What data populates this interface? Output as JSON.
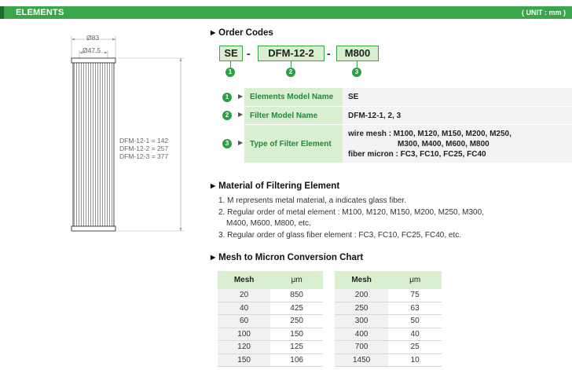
{
  "header": {
    "title": "ELEMENTS",
    "unit": "( UNIT : mm )"
  },
  "drawing": {
    "dim_outer": "Ø83",
    "dim_inner": "Ø47.5",
    "lengths": [
      "DFM-12-1 = 142",
      "DFM-12-2 = 257",
      "DFM-12-3 = 377"
    ]
  },
  "order_codes": {
    "heading": "Order Codes",
    "codes": [
      "SE",
      "DFM-12-2",
      "M800"
    ],
    "dash": "-",
    "numbers": [
      "1",
      "2",
      "3"
    ],
    "definitions": [
      {
        "num": "1",
        "label": "Elements Model Name",
        "value_lines": [
          "SE"
        ]
      },
      {
        "num": "2",
        "label": "Filter Model Name",
        "value_lines": [
          "DFM-12-1, 2, 3"
        ]
      },
      {
        "num": "3",
        "label": "Type of Filter Element",
        "value_lines": [
          "wire mesh : M100, M120, M150, M200, M250,",
          "M300, M400, M600, M800",
          "fiber micron : FC3, FC10, FC25, FC40"
        ]
      }
    ]
  },
  "material": {
    "heading": "Material of Filtering Element",
    "items": [
      [
        "1. M represents metal material, a indicates glass fiber."
      ],
      [
        "2. Regular order of metal element : M100, M120, M150, M200, M250, M300,",
        "M400, M600, M800, etc."
      ],
      [
        "3. Regular order of glass fiber element : FC3, FC10, FC25, FC40, etc."
      ]
    ]
  },
  "conversion": {
    "heading": "Mesh to Micron Conversion Chart",
    "col_mesh": "Mesh",
    "col_um": "μm",
    "left": [
      [
        "20",
        "850"
      ],
      [
        "40",
        "425"
      ],
      [
        "60",
        "250"
      ],
      [
        "100",
        "150"
      ],
      [
        "120",
        "125"
      ],
      [
        "150",
        "106"
      ]
    ],
    "right": [
      [
        "200",
        "75"
      ],
      [
        "250",
        "63"
      ],
      [
        "300",
        "50"
      ],
      [
        "400",
        "40"
      ],
      [
        "700",
        "25"
      ],
      [
        "1450",
        "10"
      ]
    ]
  }
}
